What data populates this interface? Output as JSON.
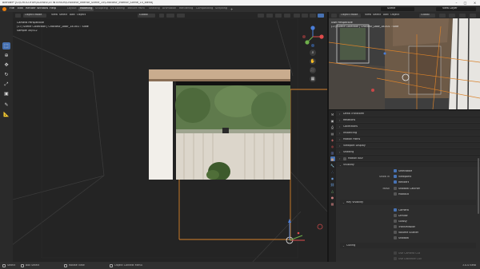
{
  "window": {
    "title": "Blender* [G:\\CHOCOFUR\\SCENES\\15 INTERIOR\\Chocofur_Interior_Scene_15\\Chocofur_Interior_Scene_15_blend]"
  },
  "menubar": {
    "items": [
      "File",
      "Edit",
      "Render",
      "Window",
      "Help"
    ],
    "workspaces": [
      "Layout",
      "Modeling",
      "Sculpting",
      "UV Editing",
      "Texture Paint",
      "Shading",
      "Animation",
      "Rendering",
      "Compositing",
      "Scripting"
    ],
    "active_workspace": "Modeling",
    "scene_label": "Scene",
    "view_layer_label": "View Layer"
  },
  "viewport": {
    "mode": "Object Mode",
    "menus": [
      "View",
      "Select",
      "Add",
      "Object"
    ],
    "transform": "Global",
    "overlay_lines": [
      "Camera Perspective",
      "(17) Scene Collection | Chocofur_Door_18.001 : Slide",
      "Sample 30/512"
    ]
  },
  "right_view": {
    "mode": "Object Mode",
    "menus": [
      "View",
      "Select",
      "Add",
      "Object"
    ],
    "transform": "Global",
    "overlay_lines": [
      "User Perspective",
      "(17) Scene Collection | Chocofur_Door_18.001 : Slide"
    ]
  },
  "properties": {
    "sections": [
      {
        "label": "Delta Transform",
        "open": false
      },
      {
        "label": "Relations",
        "open": false
      },
      {
        "label": "Collections",
        "open": false
      },
      {
        "label": "Instancing",
        "open": false
      },
      {
        "label": "Motion Paths",
        "open": false
      },
      {
        "label": "Viewport Display",
        "open": false
      },
      {
        "label": "Shading",
        "open": false
      },
      {
        "label": "Motion Blur",
        "open": false
      },
      {
        "label": "Visibility",
        "open": true
      }
    ],
    "visibility": {
      "selectable_label": "Selectable",
      "show_in_label": "Show in",
      "viewports_label": "Viewports",
      "renders_label": "Renders",
      "mask_label": "Mask",
      "shadow_catcher_label": "Shadow Catcher",
      "holdout_label": "Holdout"
    },
    "ray_visibility": {
      "label": "Ray Visibility",
      "items": [
        {
          "label": "Camera",
          "checked": true
        },
        {
          "label": "Diffuse",
          "checked": false
        },
        {
          "label": "Glossy",
          "checked": false
        },
        {
          "label": "Transmission",
          "checked": false
        },
        {
          "label": "Volume Scatter",
          "checked": false
        },
        {
          "label": "Shadow",
          "checked": false
        }
      ]
    },
    "culling": {
      "label": "Culling",
      "items": [
        "Use Camera Cull",
        "Use Distance Cull"
      ]
    }
  },
  "statusbar": {
    "left": "Select",
    "middle1": "Box Select",
    "middle2": "Rotate View",
    "middle3": "Object Context Menu",
    "right": "3.0.0 Beta"
  },
  "colors": {
    "accent": "#4772b3",
    "selection_orange": "#e8893a",
    "axis_x": "#e04b4b",
    "axis_y": "#6fb04b",
    "axis_z": "#4a7ed8"
  }
}
